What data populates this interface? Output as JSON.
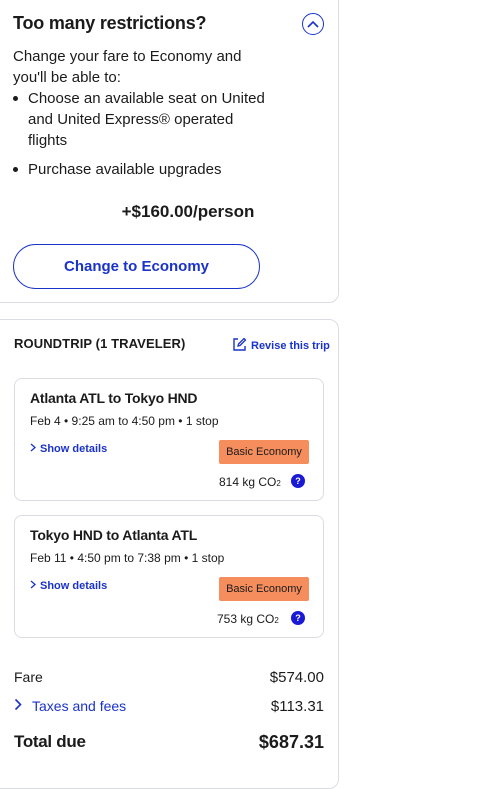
{
  "upsell": {
    "title": "Too many restrictions?",
    "description": "Change your fare to Economy and you'll be able to:",
    "bullets": [
      "Choose an available seat on United and United Express® operated flights",
      "Purchase available upgrades"
    ],
    "price": "+$160.00/person",
    "button_label": "Change to Economy"
  },
  "trip": {
    "title": "ROUNDTRIP (1 TRAVELER)",
    "revise_label": "Revise this trip",
    "flights": [
      {
        "route": "Atlanta ATL to Tokyo HND",
        "times": "Feb 4 • 9:25 am to 4:50 pm • 1 stop",
        "details_label": "Show details",
        "fare_class": "Basic Economy",
        "co2_value": "814 kg CO",
        "co2_sub": "2",
        "help": "?"
      },
      {
        "route": "Tokyo HND to Atlanta ATL",
        "times": "Feb 11 • 4:50 pm to 7:38 pm • 1 stop",
        "details_label": "Show details",
        "fare_class": "Basic Economy",
        "co2_value": "753 kg CO",
        "co2_sub": "2",
        "help": "?"
      }
    ]
  },
  "summary": {
    "fare_label": "Fare",
    "fare_value": "$574.00",
    "taxes_label": "Taxes and fees",
    "taxes_value": "$113.31",
    "total_label": "Total due",
    "total_value": "$687.31"
  },
  "colors": {
    "accent": "#1a33c9",
    "badge": "#f58d5d",
    "border": "#d9dde3"
  },
  "icons": [
    "chevron-up-icon",
    "edit-icon",
    "chevron-right-icon",
    "help-icon"
  ]
}
